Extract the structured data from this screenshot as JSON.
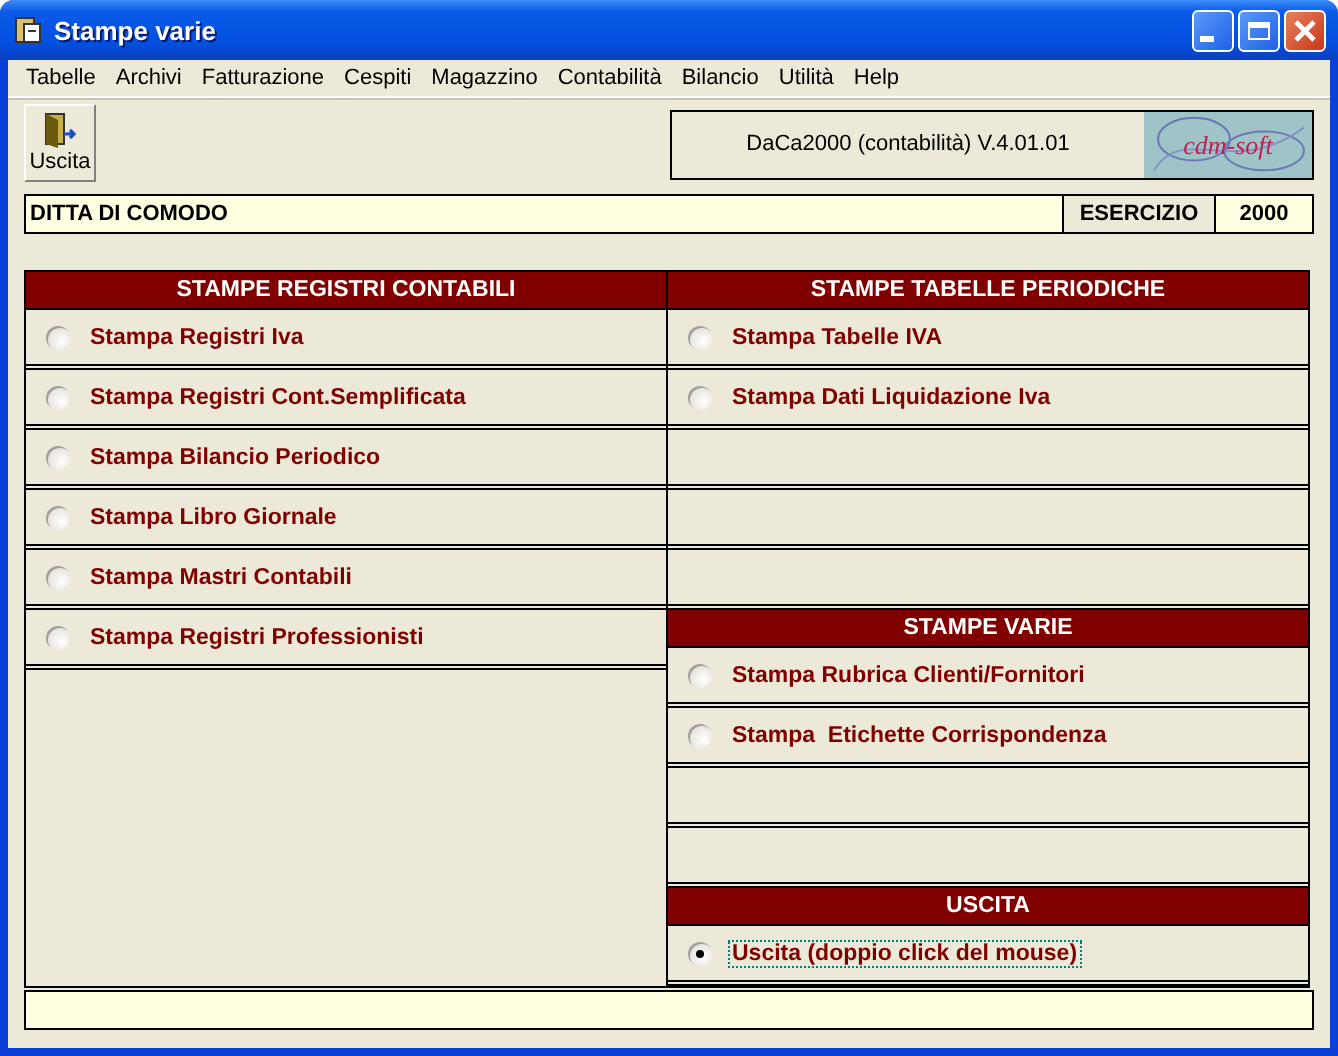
{
  "window": {
    "title": "Stampe varie"
  },
  "menu": [
    "Tabelle",
    "Archivi",
    "Fatturazione",
    "Cespiti",
    "Magazzino",
    "Contabilità",
    "Bilancio",
    "Utilità",
    "Help"
  ],
  "toolbar": {
    "exit_button": "Uscita",
    "version": "DaCa2000 (contabilità) V.4.01.01",
    "logo": "cdm-soft"
  },
  "company": {
    "name": "DITTA DI COMODO",
    "year_label": "ESERCIZIO",
    "year": "2000"
  },
  "columns": [
    {
      "sections": [
        {
          "title": "STAMPE REGISTRI CONTABILI",
          "rows": [
            {
              "kind": "option",
              "label": "Stampa Registri Iva",
              "selected": false
            },
            {
              "kind": "option",
              "label": "Stampa Registri Cont.Semplificata",
              "selected": false
            },
            {
              "kind": "option",
              "label": "Stampa Bilancio Periodico",
              "selected": false
            },
            {
              "kind": "option",
              "label": "Stampa Libro Giornale",
              "selected": false
            },
            {
              "kind": "option",
              "label": "Stampa Mastri Contabili",
              "selected": false
            },
            {
              "kind": "option",
              "label": "Stampa Registri Professionisti",
              "selected": false
            }
          ]
        }
      ]
    },
    {
      "sections": [
        {
          "title": "STAMPE TABELLE PERIODICHE",
          "rows": [
            {
              "kind": "option",
              "label": "Stampa Tabelle IVA",
              "selected": false
            },
            {
              "kind": "option",
              "label": "Stampa Dati Liquidazione Iva",
              "selected": false
            },
            {
              "kind": "blank"
            },
            {
              "kind": "blank"
            },
            {
              "kind": "blank"
            }
          ]
        },
        {
          "title": "STAMPE VARIE",
          "rows": [
            {
              "kind": "option",
              "label": "Stampa Rubrica Clienti/Fornitori",
              "selected": false
            },
            {
              "kind": "option",
              "label": "Stampa  Etichette Corrispondenza",
              "selected": false
            },
            {
              "kind": "blank"
            },
            {
              "kind": "blank"
            }
          ]
        },
        {
          "title": "USCITA",
          "rows": [
            {
              "kind": "option",
              "label": "Uscita (doppio click del mouse)",
              "selected": true
            }
          ]
        }
      ]
    }
  ]
}
